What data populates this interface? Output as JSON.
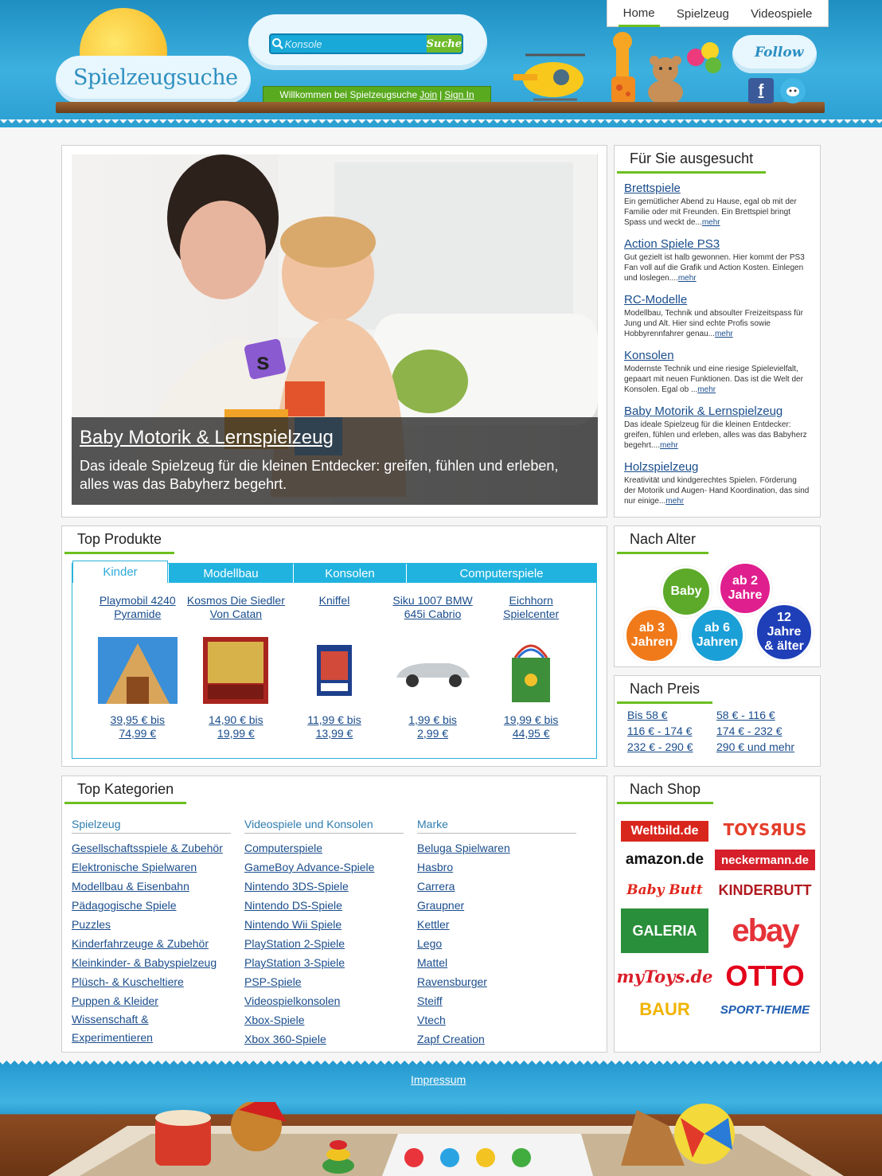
{
  "header": {
    "logo": "Spielzeugsuche",
    "search_placeholder": "Konsole",
    "search_button": "Suche",
    "welcome_text": "Willkommen bei Spielzeugsuche",
    "join": "Join",
    "sign_in": "Sign In",
    "follow": "Follow",
    "nav": [
      "Home",
      "Spielzeug",
      "Videospiele"
    ]
  },
  "hero": {
    "title": "Baby Motorik & Lernspielzeug",
    "text": "Das ideale Spielzeug für die kleinen Entdecker: greifen, fühlen und erleben, alles was das Babyherz begehrt."
  },
  "selected": {
    "title": "Für Sie ausgesucht",
    "items": [
      {
        "title": "Brettspiele",
        "text": "Ein gemütlicher Abend zu Hause, egal ob mit der Familie oder mit Freunden. Ein Brettspiel bringt Spass und weckt de...",
        "more": "mehr"
      },
      {
        "title": "Action Spiele PS3",
        "text": "Gut gezielt ist halb gewonnen. Hier kommt der PS3 Fan voll auf die Grafik und Action Kosten. Einlegen und loslegen....",
        "more": "mehr"
      },
      {
        "title": "RC-Modelle",
        "text": "Modellbau, Technik und absoulter Freizeitspass für Jung und Alt. Hier sind echte Profis sowie Hobbyrennfahrer genau...",
        "more": "mehr"
      },
      {
        "title": "Konsolen",
        "text": "Modernste Technik und eine riesige Spielevielfalt, gepaart mit neuen Funktionen. Das ist die Welt der Konsolen. Egal ob ...",
        "more": "mehr"
      },
      {
        "title": "Baby Motorik & Lernspielzeug",
        "text": "Das ideale Spielzeug für die kleinen Entdecker: greifen, fühlen und erleben, alles was das Babyherz begehrt....",
        "more": "mehr"
      },
      {
        "title": "Holzspielzeug",
        "text": "Kreativität und kindgerechtes Spielen. Förderung der Motorik und Augen- Hand Koordination, das sind nur einige...",
        "more": "mehr"
      }
    ]
  },
  "products": {
    "title": "Top Produkte",
    "tabs": [
      "Kinder",
      "Modellbau",
      "Konsolen",
      "Computerspiele"
    ],
    "items": [
      {
        "name_1": "Playmobil 4240",
        "name_2": "Pyramide",
        "price_1": "39,95 € bis",
        "price_2": "74,99 €"
      },
      {
        "name_1": "Kosmos Die Siedler",
        "name_2": "Von Catan",
        "price_1": "14,90 € bis",
        "price_2": "19,99 €"
      },
      {
        "name_1": "Kniffel",
        "name_2": "",
        "price_1": "11,99 € bis",
        "price_2": "13,99 €"
      },
      {
        "name_1": "Siku 1007 BMW",
        "name_2": "645i Cabrio",
        "price_1": "1,99 € bis",
        "price_2": "2,99 €"
      },
      {
        "name_1": "Eichhorn",
        "name_2": "Spielcenter",
        "price_1": "19,99 € bis",
        "price_2": "44,95 €"
      }
    ]
  },
  "alter": {
    "title": "Nach Alter",
    "b1": "Baby",
    "b2_1": "ab 2",
    "b2_2": "Jahre",
    "b3_1": "ab 3",
    "b3_2": "Jahren",
    "b4_1": "ab 6",
    "b4_2": "Jahren",
    "b5_1": "12",
    "b5_2": "Jahre",
    "b5_3": "& älter"
  },
  "preis": {
    "title": "Nach Preis",
    "ranges": [
      "Bis 58 €",
      "58 € - 116 €",
      "116 € - 174 €",
      "174 € - 232 €",
      "232 € - 290 €",
      "290 € und mehr"
    ]
  },
  "kategorien": {
    "title": "Top Kategorien",
    "col1": {
      "head": "Spielzeug",
      "links": [
        "Gesellschaftsspiele & Zubehör",
        "Elektronische Spielwaren",
        "Modellbau & Eisenbahn",
        "Pädagogische Spiele",
        "Puzzles",
        "Kinderfahrzeuge & Zubehör",
        "Kleinkinder- & Babyspielzeug",
        "Plüsch- & Kuscheltiere",
        "Puppen & Kleider",
        "Wissenschaft &",
        "Experimentieren"
      ]
    },
    "col2": {
      "head": "Videospiele und Konsolen",
      "links": [
        "Computerspiele",
        "GameBoy Advance-Spiele",
        "Nintendo 3DS-Spiele",
        "Nintendo DS-Spiele",
        "Nintendo Wii Spiele",
        "PlayStation 2-Spiele",
        "PlayStation 3-Spiele",
        "PSP-Spiele",
        "Videospielkonsolen",
        "Xbox-Spiele",
        "Xbox 360-Spiele"
      ]
    },
    "col3": {
      "head": "Marke",
      "links": [
        "Beluga Spielwaren",
        "Hasbro",
        "Carrera",
        "Graupner",
        "Kettler",
        "Lego",
        "Mattel",
        "Ravensburger",
        "Steiff",
        "Vtech",
        "Zapf Creation"
      ]
    }
  },
  "shop": {
    "title": "Nach Shop",
    "logos": [
      "Weltbild.de",
      "TOYSЯUS",
      "amazon.de",
      "neckermann.de",
      "Baby Butt",
      "KINDERBUTT",
      "GALERIA",
      "ebay",
      "myToys.de",
      "OTTO",
      "BAUR",
      "SPORT-THIEME"
    ]
  },
  "footer": {
    "impressum": "Impressum"
  }
}
